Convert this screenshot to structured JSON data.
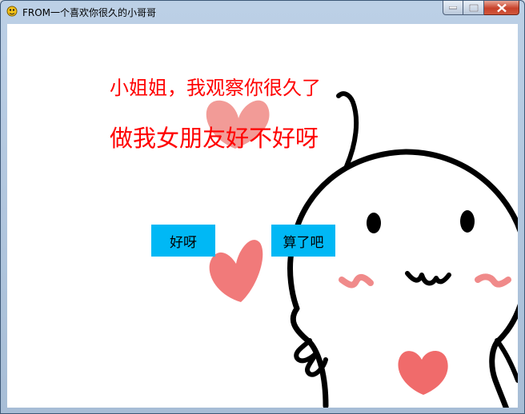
{
  "window": {
    "title": "FROM一个喜欢你很久的小哥哥",
    "controls": {
      "minimize_icon": "minimize-icon",
      "maximize_icon": "maximize-icon",
      "close_icon": "close-icon"
    }
  },
  "content": {
    "line1": "小姐姐，我观察你很久了",
    "line2": "做我女朋友好不好呀",
    "text_color": "#ff0000"
  },
  "buttons": {
    "yes_label": "好呀",
    "no_label": "算了吧",
    "color": "#00b8f5"
  },
  "illustration": {
    "subject": "cartoon-character-with-hearts"
  }
}
